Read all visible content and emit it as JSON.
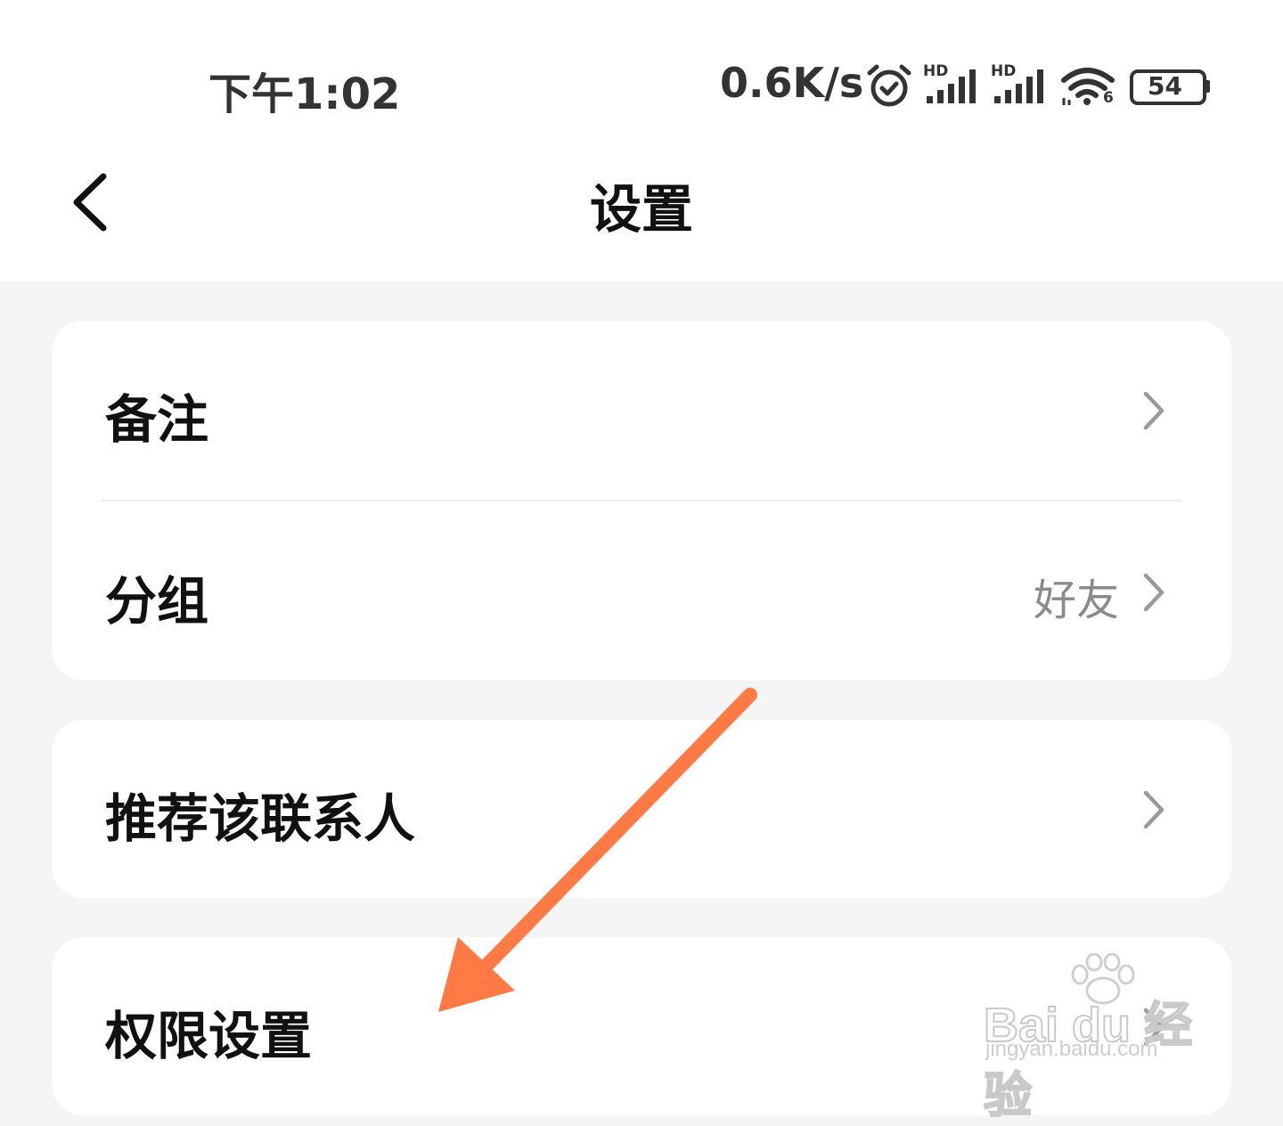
{
  "status_bar": {
    "time": "下午1:02",
    "net_speed": "0.6K/s",
    "icons": [
      "alarm-icon",
      "hd-signal-icon",
      "hd-signal-icon",
      "wifi-icon",
      "battery-icon"
    ],
    "signal_badge": "HD",
    "wifi_badge": "6",
    "battery_level": "54"
  },
  "header": {
    "title": "设置",
    "back_icon": "chevron-left-icon"
  },
  "sections": [
    {
      "rows": [
        {
          "label": "备注",
          "value": ""
        },
        {
          "label": "分组",
          "value": "好友"
        }
      ]
    },
    {
      "rows": [
        {
          "label": "推荐该联系人",
          "value": ""
        }
      ]
    },
    {
      "rows": [
        {
          "label": "权限设置",
          "value": ""
        }
      ]
    }
  ],
  "annotation": {
    "color": "#ff7a45"
  },
  "watermark": {
    "brand": "Bai du 经验",
    "url": "jingyan.baidu.com"
  },
  "colors": {
    "background": "#f5f5f5",
    "card": "#ffffff",
    "secondary_text": "#8a8a8a"
  }
}
